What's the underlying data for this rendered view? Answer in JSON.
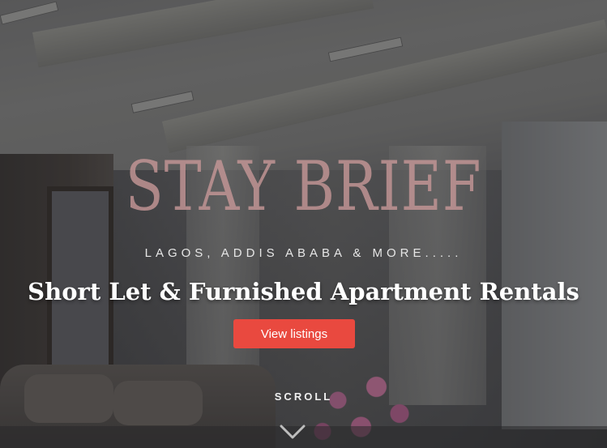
{
  "hero": {
    "brand": "STAY BRIEF",
    "tagline": "LAGOS, ADDIS ABABA & MORE.....",
    "headline": "Short Let & Furnished Apartment Rentals",
    "cta_label": "View listings",
    "scroll_label": "SCROLL",
    "scroll_icon": "chevron-down-icon"
  },
  "colors": {
    "accent": "#e9493f",
    "brand_text": "#c49696",
    "text": "#ffffff"
  }
}
